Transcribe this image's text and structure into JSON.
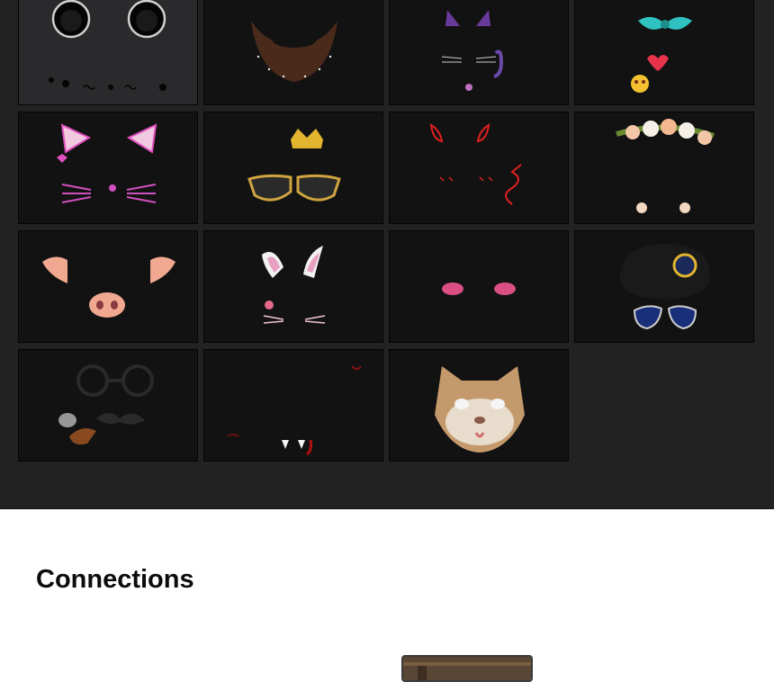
{
  "filters": [
    {
      "name": "mouse-ears-filter"
    },
    {
      "name": "beard-filter"
    },
    {
      "name": "purple-cat-filter"
    },
    {
      "name": "hearts-bow-filter"
    },
    {
      "name": "pink-cat-ears-filter"
    },
    {
      "name": "crown-sunglasses-filter"
    },
    {
      "name": "red-devil-filter"
    },
    {
      "name": "flower-crown-filter"
    },
    {
      "name": "pig-filter"
    },
    {
      "name": "bunny-ears-filter"
    },
    {
      "name": "pink-blush-filter"
    },
    {
      "name": "police-hat-aviators-filter"
    },
    {
      "name": "glasses-pipe-mustache-filter"
    },
    {
      "name": "vampire-fangs-filter"
    },
    {
      "name": "persian-cat-face-filter"
    }
  ],
  "section": {
    "title": "Connections"
  }
}
